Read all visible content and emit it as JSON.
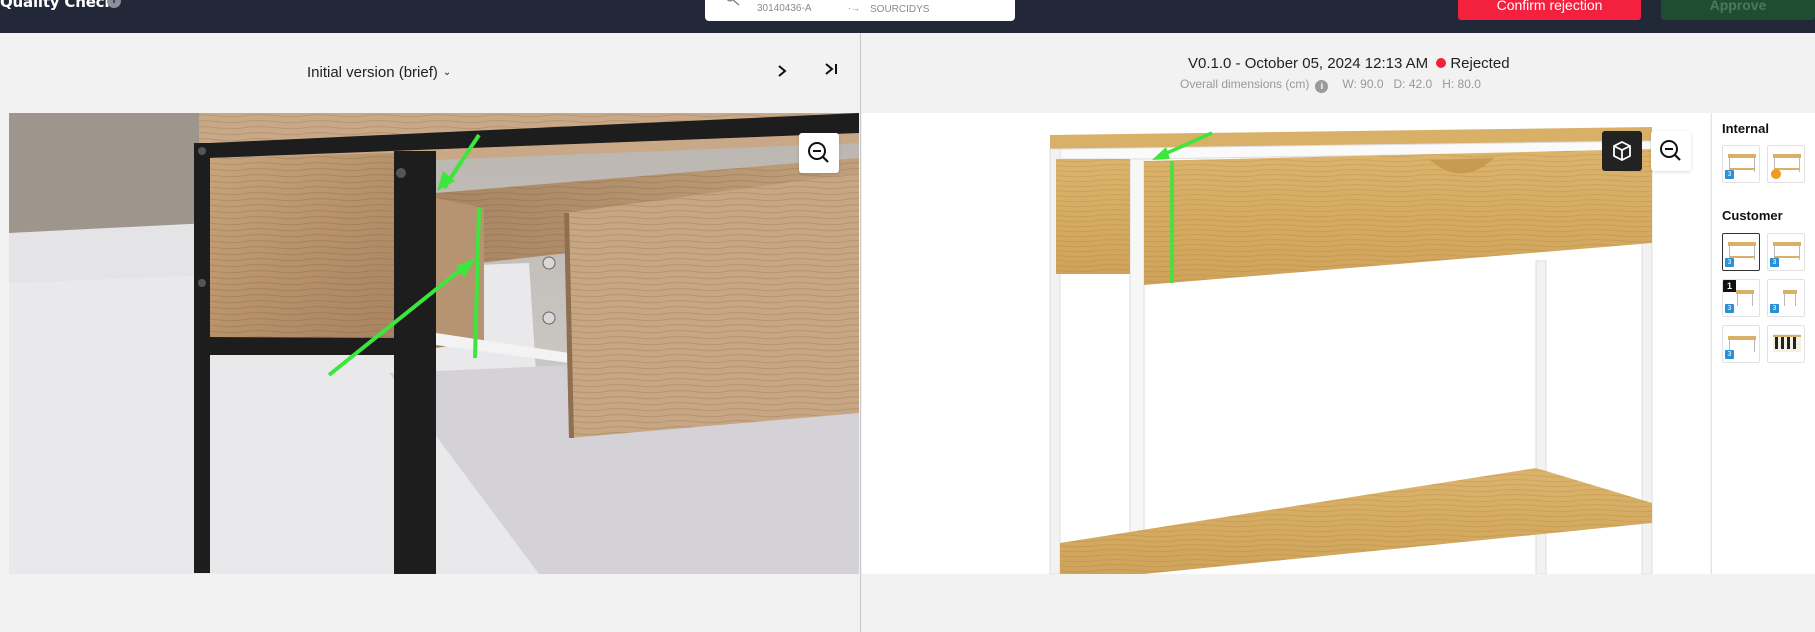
{
  "header": {
    "app_title": "Quality Check",
    "sku": "30140436-A",
    "source": "SOURCIDYS",
    "confirm_rejection_label": "Confirm rejection",
    "approve_label": "Approve"
  },
  "left_panel": {
    "version_label": "Initial version (brief)"
  },
  "right_panel": {
    "version_info": "V0.1.0 - October 05, 2024 12:13 AM",
    "status": "Rejected",
    "dims_label": "Overall dimensions (cm)",
    "width": "W: 90.0",
    "depth": "D: 42.0",
    "height": "H: 80.0"
  },
  "thumbnails": {
    "internal_title": "Internal",
    "customer_title": "Customer",
    "badge_one": "1",
    "badge_three": "3"
  },
  "colors": {
    "topbar": "#232838",
    "reject": "#f4213e",
    "approve": "#1f4d31",
    "annotation": "#3ce63c",
    "oak": "#d2a860"
  },
  "icons": [
    "info-icon",
    "key-icon",
    "chevron-down-icon",
    "chevron-right-icon",
    "skip-last-icon",
    "zoom-out-icon",
    "cube-icon",
    "blender-icon"
  ]
}
